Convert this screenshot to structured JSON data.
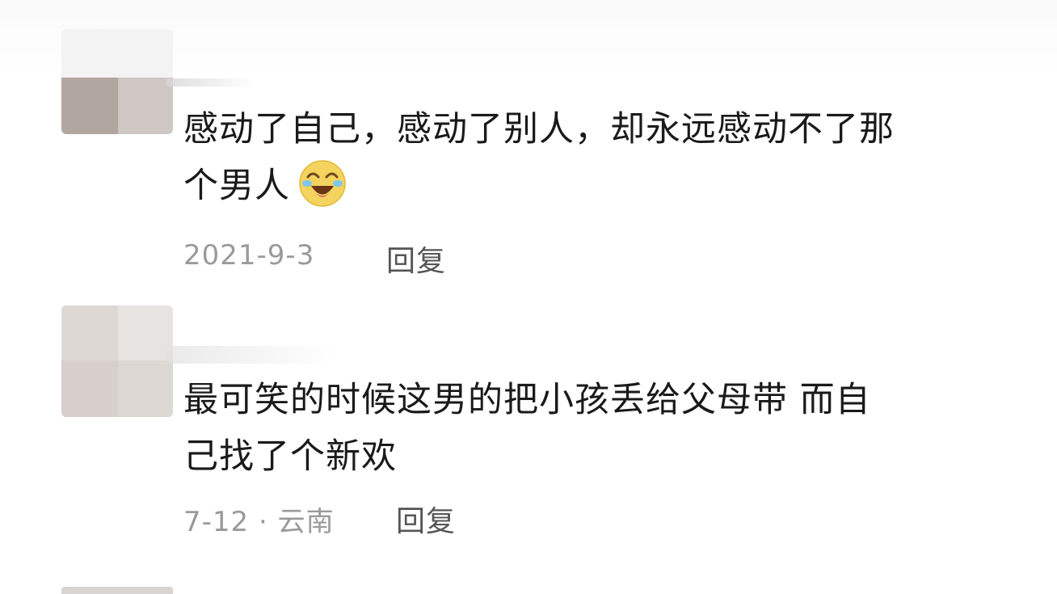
{
  "comments": [
    {
      "text_line1": "感动了自己，感动了别人，却永远感动不了那",
      "text_line2": "个男人",
      "emoji": "laughing-crying-emoji",
      "date": "2021-9-3",
      "reply_label": "回复"
    },
    {
      "text_line1": "最可笑的时候这男的把小孩丢给父母带 而自",
      "text_line2": "己找了个新欢",
      "date": "7-12",
      "location": "· 云南",
      "reply_label": "回复"
    }
  ],
  "colors": {
    "text": "#1a1a1a",
    "meta": "#9a9a9a",
    "reply": "#555555",
    "emoji_face": "#f4d35e"
  }
}
